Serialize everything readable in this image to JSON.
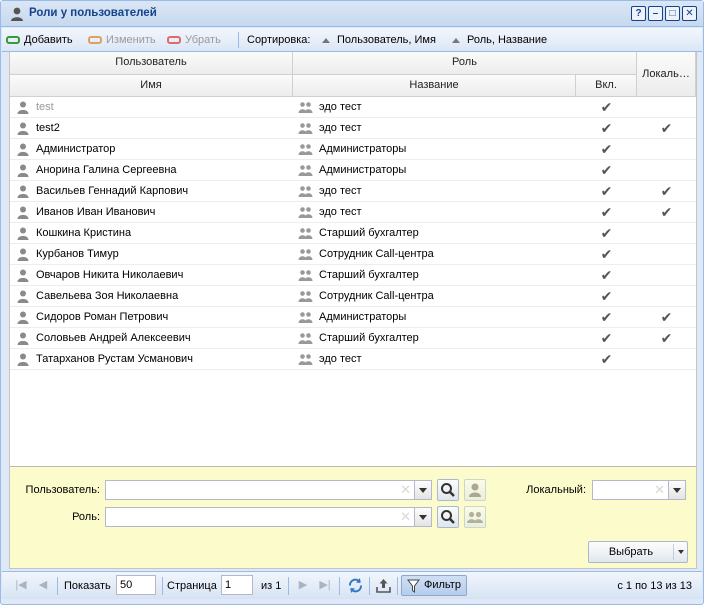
{
  "window": {
    "title": "Роли у пользователей",
    "tools": [
      "?",
      "–",
      "□",
      "✕"
    ]
  },
  "toolbar": {
    "add_label": "Добавить",
    "edit_label": "Изменить",
    "remove_label": "Убрать",
    "sort_label": "Сортировка:",
    "sort_user": "Пользователь, Имя",
    "sort_role": "Роль, Название",
    "colors": {
      "add": "#3a9a3a",
      "edit": "#e0a060",
      "remove": "#e06a6a"
    }
  },
  "grid": {
    "group_user": "Пользователь",
    "group_role": "Роль",
    "col_name": "Имя",
    "col_role_name": "Название",
    "col_enabled": "Вкл.",
    "col_local": "Локаль…",
    "rows": [
      {
        "user": "test",
        "role": "эдо тест",
        "enabled": "✔",
        "local": "",
        "muted": true
      },
      {
        "user": "test2",
        "role": "эдо тест",
        "enabled": "✔",
        "local": "✔",
        "muted": false
      },
      {
        "user": "Администратор",
        "role": "Администраторы",
        "enabled": "✔",
        "local": "",
        "muted": false
      },
      {
        "user": "Анорина Галина Сергеевна",
        "role": "Администраторы",
        "enabled": "✔",
        "local": "",
        "muted": false
      },
      {
        "user": "Васильев Геннадий Карпович",
        "role": "эдо тест",
        "enabled": "✔",
        "local": "✔",
        "muted": false
      },
      {
        "user": "Иванов Иван Иванович",
        "role": "эдо тест",
        "enabled": "✔",
        "local": "✔",
        "muted": false
      },
      {
        "user": "Кошкина Кристина",
        "role": "Старший бухгалтер",
        "enabled": "✔",
        "local": "",
        "muted": false
      },
      {
        "user": "Курбанов Тимур",
        "role": "Сотрудник Call-центра",
        "enabled": "✔",
        "local": "",
        "muted": false
      },
      {
        "user": "Овчаров Никита Николаевич",
        "role": "Старший бухгалтер",
        "enabled": "✔",
        "local": "",
        "muted": false
      },
      {
        "user": "Савельева Зоя Николаевна",
        "role": "Сотрудник Call-центра",
        "enabled": "✔",
        "local": "",
        "muted": false
      },
      {
        "user": "Сидоров Роман Петрович",
        "role": "Администраторы",
        "enabled": "✔",
        "local": "✔",
        "muted": false
      },
      {
        "user": "Соловьев Андрей Алексеевич",
        "role": "Старший бухгалтер",
        "enabled": "✔",
        "local": "✔",
        "muted": false
      },
      {
        "user": "Татарханов Рустам Усманович",
        "role": "эдо тест",
        "enabled": "✔",
        "local": "",
        "muted": false
      }
    ]
  },
  "filter": {
    "user_label": "Пользователь:",
    "role_label": "Роль:",
    "local_label": "Локальный:",
    "user_value": "",
    "role_value": "",
    "local_value": "",
    "choose_label": "Выбрать",
    "background": "#fbfbcb"
  },
  "pager": {
    "show_label": "Показать",
    "page_size": "50",
    "page_label": "Страница",
    "page_value": "1",
    "of_label": "из 1",
    "filter_label": "Фильтр",
    "summary": "с 1 по 13 из 13"
  }
}
